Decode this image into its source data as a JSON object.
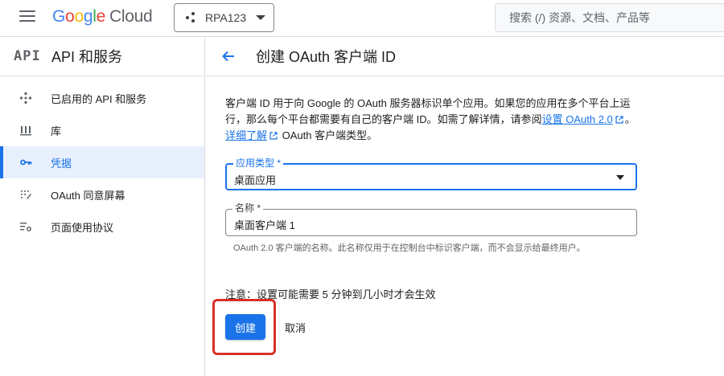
{
  "topbar": {
    "logo_letters": [
      "G",
      "o",
      "o",
      "g",
      "l",
      "e"
    ],
    "logo_product": "Cloud",
    "project_name": "RPA123",
    "search_placeholder": "搜索 (/) 资源、文档、产品等"
  },
  "sidebar": {
    "logo_text": "API",
    "title": "API 和服务",
    "items": [
      {
        "label": "已启用的 API 和服务",
        "icon": "enabled-apis-icon",
        "active": false
      },
      {
        "label": "库",
        "icon": "library-icon",
        "active": false
      },
      {
        "label": "凭据",
        "icon": "key-icon",
        "active": true
      },
      {
        "label": "OAuth 同意屏幕",
        "icon": "consent-screen-icon",
        "active": false
      },
      {
        "label": "页面使用协议",
        "icon": "page-agreement-icon",
        "active": false
      }
    ]
  },
  "main": {
    "title": "创建 OAuth 客户端 ID",
    "description": {
      "part1": "客户端 ID 用于向 Google 的 OAuth 服务器标识单个应用。如果您的应用在多个平台上运行，那么每个平台都需要有自己的客户端 ID。如需了解详情，请参阅",
      "link1": "设置 OAuth 2.0",
      "part2": "。",
      "link2": "详细了解",
      "part3": " OAuth 客户端类型。"
    },
    "app_type": {
      "label": "应用类型 *",
      "value": "桌面应用"
    },
    "name": {
      "label": "名称 *",
      "value": "桌面客户端 1",
      "helper": "OAuth 2.0 客户端的名称。此名称仅用于在控制台中标识客户端，而不会显示给最终用户。"
    },
    "notice": "注意：设置可能需要 5 分钟到几小时才会生效",
    "create_label": "创建",
    "cancel_label": "取消"
  },
  "colors": {
    "accent": "#1a73e8",
    "highlight": "#d93025"
  }
}
